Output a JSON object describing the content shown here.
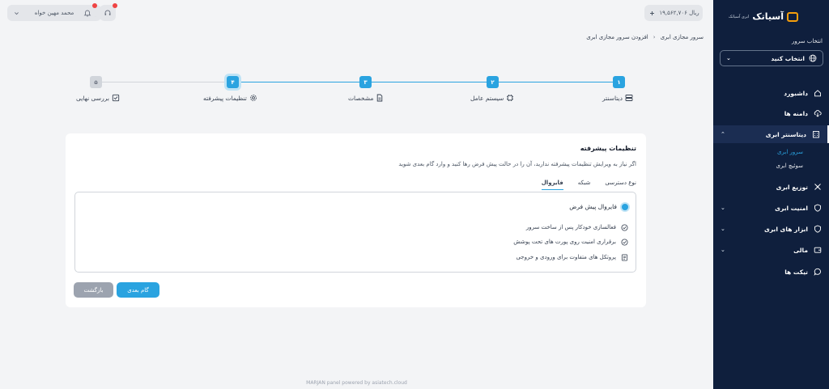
{
  "topbar": {
    "user_name": "محمد مهین خواه",
    "balance": "۱۹,۵۶۲,۷۰۶ ریال"
  },
  "breadcrumb": [
    "سرور مجازی ابری",
    "افزودن سرور مجازی ابری"
  ],
  "stepper": {
    "steps": [
      {
        "number": "۱",
        "label": "دیتاسنتر",
        "icon": "server-icon",
        "state": "done"
      },
      {
        "number": "۲",
        "label": "سیستم عامل",
        "icon": "chip-icon",
        "state": "done"
      },
      {
        "number": "۳",
        "label": "مشخصات",
        "icon": "document-icon",
        "state": "done"
      },
      {
        "number": "۴",
        "label": "تنظیمات پیشرفته",
        "icon": "gear-icon",
        "state": "current"
      },
      {
        "number": "۵",
        "label": "بررسی نهایی",
        "icon": "check-square-icon",
        "state": "pending"
      }
    ]
  },
  "card": {
    "title": "تنظیمات پیشرفته",
    "description": "اگر نیاز به ویرایش تنظیمات پیشرفته ندارید، آن را در حالت پیش فرض رها کنید و وارد گام بعدی شوید",
    "tabs": [
      {
        "label": "نوع دسترسی",
        "active": false
      },
      {
        "label": "شبکه",
        "active": false
      },
      {
        "label": "فایروال",
        "active": true
      }
    ],
    "firewall": {
      "option_label": "فایروال پیش فرض",
      "features": [
        "فعالسازی خودکار پس از ساخت سرور",
        "برقراری امنیت روی پورت های تحت پوشش",
        "پروتکل های متفاوت برای ورودی و خروجی"
      ]
    },
    "next_label": "گام بعدی",
    "back_label": "بازگشت"
  },
  "footer": "MARJAN panel powered by asiatech.cloud",
  "sidebar": {
    "logo_text": "آسیاتک",
    "logo_subtext": "ابری آسیاتک",
    "server_select_label": "انتخاب سرور",
    "server_select_value": "انتخاب کنید",
    "items": [
      {
        "label": "داشبورد",
        "icon": "home-icon"
      },
      {
        "label": "دامنه ها",
        "icon": "cloud-download-icon"
      },
      {
        "label": "دیتاسنتر ابری",
        "icon": "building-icon"
      },
      {
        "label": "توزیع ابری",
        "icon": "network-icon"
      },
      {
        "label": "امنیت ابری",
        "icon": "shield-icon"
      },
      {
        "label": "ابزار های ابری",
        "icon": "shield-icon"
      },
      {
        "label": "مالی",
        "icon": "wallet-icon"
      },
      {
        "label": "تیکت ها",
        "icon": "chat-icon"
      }
    ],
    "subitems": [
      "سرور ابری",
      "سوئیچ ابری"
    ]
  },
  "colors": {
    "accent": "#2aa3e0",
    "sidebar_bg": "#0f1f3d",
    "page_bg": "#f3f4f6",
    "notification": "#ef4444"
  }
}
